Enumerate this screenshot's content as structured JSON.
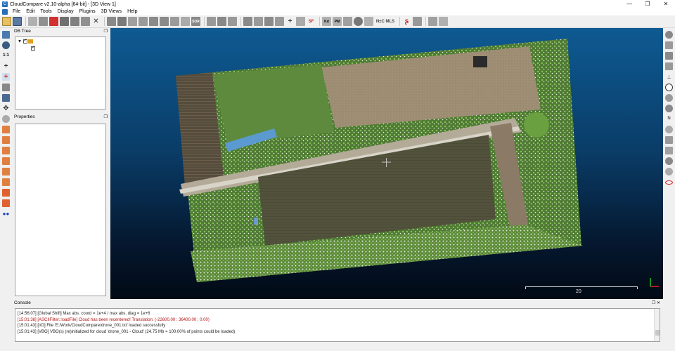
{
  "window": {
    "title": "CloudCompare v2.10-alpha [64-bit] - [3D View 1]",
    "controls": [
      "—",
      "❐",
      "✕"
    ]
  },
  "menu": {
    "items": [
      "File",
      "Edit",
      "Tools",
      "Display",
      "Plugins",
      "3D Views",
      "Help"
    ],
    "mdi_controls": [
      "—",
      "❐",
      "✕"
    ]
  },
  "toolbar": {
    "sf_label": "SF",
    "sor_label": "SOR",
    "ncmls_label": "N±C MLS",
    "text_labels": [
      "Kd",
      "PM"
    ]
  },
  "left_toolbar": {
    "scale_label": "1:1"
  },
  "right_toolbar": {
    "north_label": "N"
  },
  "db_tree": {
    "title": "DB Tree",
    "float_icon": "❐"
  },
  "properties": {
    "title": "Properties",
    "float_icon": "❐"
  },
  "view3d": {
    "scale_value": "20"
  },
  "console": {
    "title": "Console",
    "float_icon": "❐ ✕",
    "lines": [
      {
        "text": "[14:56:07] [Global Shift] Max abs. coord = 1e+4 / max abs. diag = 1e+6",
        "level": "normal"
      },
      {
        "text": "[15:01:38] [ASCIIFilter::loadFile] Cloud has been recentered! Translation: (-22600.00 ; 36400.00 ; 0.00)",
        "level": "warn"
      },
      {
        "text": "[15:01:43] [I/O] File 'E:/Work/CloudCompare/drone_001.txt' loaded successfully",
        "level": "normal"
      },
      {
        "text": "[15:01:43] [VBO] VBO(s) (re)initialized for cloud 'drone_001 - Cloud' (24.75 Mb = 100.00% of points could be loaded)",
        "level": "normal"
      }
    ]
  },
  "colors": {
    "accent": "#2a6ebb",
    "warn_text": "#b01010",
    "axis_x": "#e02020",
    "axis_y": "#20c020"
  }
}
